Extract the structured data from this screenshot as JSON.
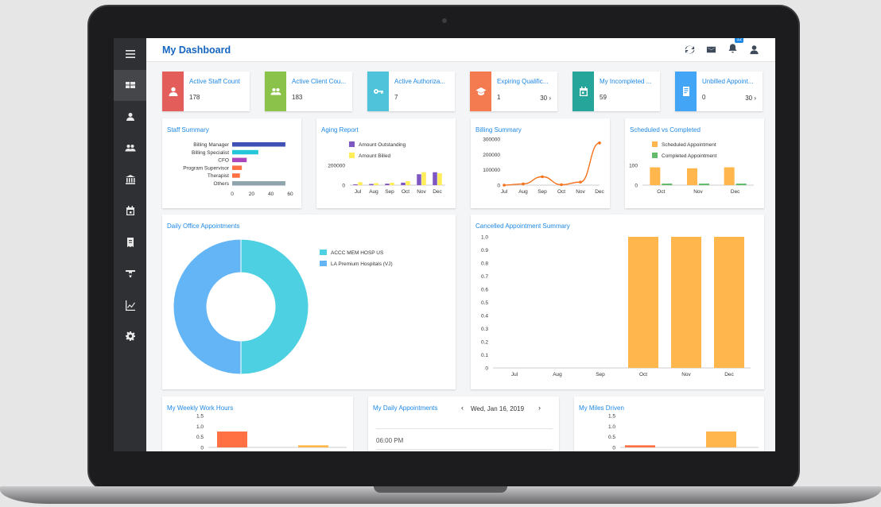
{
  "header": {
    "title": "My Dashboard",
    "notification_count": "12"
  },
  "sidebar": {
    "items": [
      "menu-icon",
      "dashboard-icon",
      "person-icon",
      "people-icon",
      "bank-icon",
      "calendar-icon",
      "receipt-icon",
      "billing-icon",
      "chart-icon",
      "gear-icon"
    ]
  },
  "kpis": [
    {
      "label": "Active Staff Count",
      "value": "178",
      "value2": "",
      "color": "#e35d5b",
      "icon": "staff-icon"
    },
    {
      "label": "Active Client Cou...",
      "value": "183",
      "value2": "",
      "color": "#8bc34a",
      "icon": "clients-icon"
    },
    {
      "label": "Active Authoriza...",
      "value": "7",
      "value2": "",
      "color": "#4fc3d9",
      "icon": "key-icon"
    },
    {
      "label": "Expiring Qualific...",
      "value": "1",
      "value2": "30",
      "color": "#f47a50",
      "icon": "graduation-icon"
    },
    {
      "label": "My Incompleted ...",
      "value": "59",
      "value2": "",
      "color": "#26a69a",
      "icon": "calendar-icon"
    },
    {
      "label": "Unbilled Appoint...",
      "value": "0",
      "value2": "30",
      "color": "#42a5f5",
      "icon": "document-icon"
    }
  ],
  "panels": {
    "staff_summary": "Staff Summary",
    "aging_report": "Aging Report",
    "billing_summary": "Billing Summary",
    "scheduled_vs_completed": "Scheduled vs Completed",
    "daily_office": "Daily Office Appointments",
    "cancelled": "Cancelled Appointment Summary",
    "weekly_hours": "My Weekly Work Hours",
    "daily_appointments": "My Daily Appointments",
    "daily_date": "Wed, Jan 16, 2019",
    "daily_time": "06:00 PM",
    "miles": "My Miles Driven"
  },
  "chart_data": [
    {
      "id": "staff",
      "type": "bar",
      "orientation": "horizontal",
      "title": "Staff Summary",
      "categories": [
        "Billing Manager",
        "Billing Specialist",
        "CFO",
        "Program Supervisor",
        "Therapist",
        "Others"
      ],
      "values": [
        55,
        27,
        15,
        10,
        8,
        55
      ],
      "colors": [
        "#3f51b5",
        "#26c6da",
        "#ab47bc",
        "#ff7043",
        "#ff7043",
        "#90a4ae"
      ],
      "xticks": [
        "0",
        "20",
        "40",
        "60"
      ],
      "xlim": [
        0,
        60
      ]
    },
    {
      "id": "aging",
      "type": "bar",
      "title": "Aging Report",
      "categories": [
        "Jul",
        "Aug",
        "Sep",
        "Oct",
        "Nov",
        "Dec"
      ],
      "series": [
        {
          "name": "Amount Outstanding",
          "color": "#7e57c2",
          "values": [
            8000,
            12000,
            15000,
            25000,
            110000,
            130000
          ]
        },
        {
          "name": "Amount Billed",
          "color": "#ffee58",
          "values": [
            30000,
            20000,
            25000,
            40000,
            130000,
            120000
          ]
        }
      ],
      "yticks": [
        "0",
        "200000"
      ],
      "ylim": [
        0,
        320000
      ]
    },
    {
      "id": "billing",
      "type": "line",
      "title": "Billing Summary",
      "categories": [
        "Jul",
        "Aug",
        "Sep",
        "Oct",
        "Nov",
        "Dec"
      ],
      "values": [
        0,
        8000,
        55000,
        3000,
        20000,
        275000
      ],
      "color": "#f4731c",
      "yticks": [
        "0",
        "100000",
        "200000",
        "300000"
      ],
      "ylim": [
        0,
        300000
      ]
    },
    {
      "id": "scheduled",
      "type": "bar",
      "title": "Scheduled vs Completed",
      "categories": [
        "Oct",
        "Nov",
        "Dec"
      ],
      "series": [
        {
          "name": "Scheduled Appointment",
          "color": "#ffb74d",
          "values": [
            90,
            85,
            90
          ]
        },
        {
          "name": "Completed Appointment",
          "color": "#66bb6a",
          "values": [
            8,
            8,
            8
          ]
        }
      ],
      "yticks": [
        "0",
        "100"
      ],
      "ylim": [
        0,
        160
      ]
    },
    {
      "id": "donut",
      "type": "pie",
      "title": "Daily Office Appointments",
      "labels": [
        "ACCC MEM HOSP US",
        "LA Premium Hospitals (VJ)"
      ],
      "values": [
        50,
        50
      ],
      "colors": [
        "#4dd0e1",
        "#64b5f6"
      ]
    },
    {
      "id": "cancelled",
      "type": "bar",
      "title": "Cancelled Appointment Summary",
      "categories": [
        "Jul",
        "Aug",
        "Sep",
        "Oct",
        "Nov",
        "Dec"
      ],
      "values": [
        0,
        0,
        0,
        1,
        1,
        1
      ],
      "color": "#ffb74d",
      "yticks": [
        "0",
        "0.1",
        "0.2",
        "0.3",
        "0.4",
        "0.5",
        "0.6",
        "0.7",
        "0.8",
        "0.9",
        "1.0"
      ],
      "ylim": [
        0,
        1
      ]
    },
    {
      "id": "weekly",
      "type": "bar",
      "title": "My Weekly Work Hours",
      "values": [
        0.75,
        0.1
      ],
      "colors": [
        "#ff7043",
        "#ffb74d"
      ],
      "yticks": [
        "0",
        "0.5",
        "1.0",
        "1.5"
      ],
      "ylim": [
        0,
        1.5
      ]
    },
    {
      "id": "miles",
      "type": "bar",
      "title": "My Miles Driven",
      "values": [
        0.1,
        0.75
      ],
      "colors": [
        "#ff7043",
        "#ffb74d"
      ],
      "yticks": [
        "0",
        "0.5",
        "1.0",
        "1.5"
      ],
      "ylim": [
        0,
        1.5
      ]
    }
  ]
}
